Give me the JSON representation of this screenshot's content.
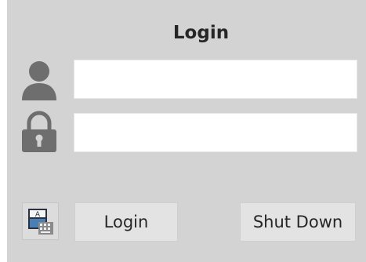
{
  "dialog": {
    "title": "Login"
  },
  "fields": {
    "username": {
      "icon": "user-icon",
      "value": "",
      "placeholder": ""
    },
    "password": {
      "icon": "lock-icon",
      "value": "",
      "placeholder": ""
    }
  },
  "buttons": {
    "keyboard_layout": {
      "icon": "keyboard-layout-icon",
      "glyph": "A"
    },
    "login_label": "Login",
    "shutdown_label": "Shut Down"
  },
  "colors": {
    "panel_background": "#d3d3d3",
    "field_background": "#ffffff",
    "button_background": "#e3e3e3",
    "icon_gray": "#6e6e6e",
    "text": "#262626"
  }
}
